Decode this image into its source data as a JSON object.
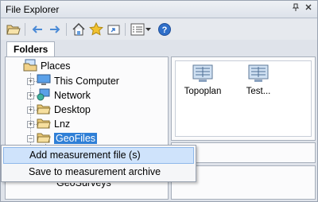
{
  "window": {
    "title": "File Explorer",
    "pin_icon": "pin-icon",
    "close_icon": "close-icon"
  },
  "toolbar": {
    "items": [
      "open-folder-icon",
      "back-arrow-icon",
      "forward-arrow-icon",
      "home-icon",
      "favorites-star-icon",
      "export-icon",
      "view-list-icon",
      "dropdown-caret-icon",
      "help-icon"
    ]
  },
  "tabs": {
    "folders": "Folders"
  },
  "tree": {
    "root": "Places",
    "items": [
      {
        "label": "This Computer"
      },
      {
        "label": "Network"
      },
      {
        "label": "Desktop"
      },
      {
        "label": "Lnz"
      },
      {
        "label": "GeoFiles"
      }
    ],
    "partial": "GeoSurveys"
  },
  "files": [
    {
      "label": "Topoplan"
    },
    {
      "label": "Test..."
    }
  ],
  "context_menu": {
    "items": [
      {
        "label": "Add measurement file (s)"
      },
      {
        "label": "Save to measurement archive"
      }
    ]
  },
  "colors": {
    "selection": "#2f7fd6",
    "menu_hover": "#cfe3fb",
    "accent": "#3a78c9"
  }
}
